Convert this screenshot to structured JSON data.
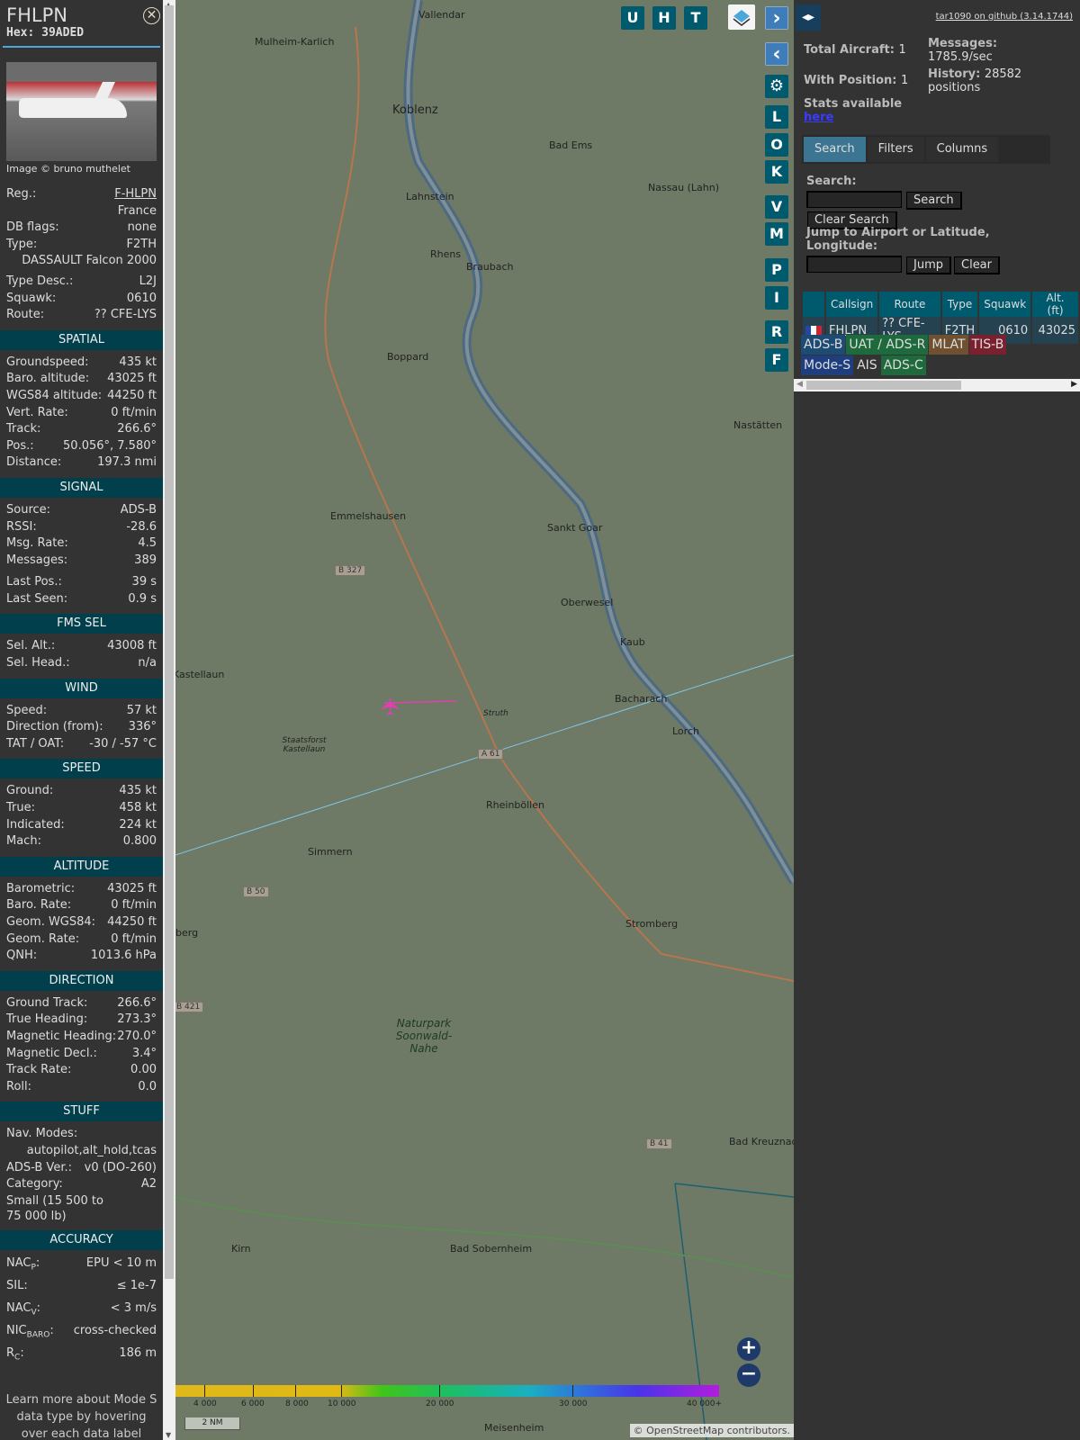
{
  "aircraft": {
    "callsign": "FHLPN",
    "hex_label": "Hex:",
    "hex": "39ADED",
    "image_credit": "Image © bruno muthelet"
  },
  "info": [
    {
      "label": "Reg.:",
      "value": "F-HLPN"
    },
    {
      "value": "France"
    },
    {
      "label": "DB flags:",
      "value": "none"
    },
    {
      "label": "Type:",
      "value": "F2TH"
    },
    {
      "value": "DASSAULT Falcon 2000"
    },
    {
      "label": "Type Desc.:",
      "value": "L2J"
    },
    {
      "label": "Squawk:",
      "value": "0610"
    },
    {
      "label": "Route:",
      "value": "?? CFE-LYS"
    }
  ],
  "sections": {
    "spatial": {
      "title": "SPATIAL",
      "rows": [
        {
          "label": "Groundspeed:",
          "value": "435 kt"
        },
        {
          "label": "Baro. altitude:",
          "value": "43025 ft"
        },
        {
          "label": "WGS84 altitude:",
          "value": "44250 ft"
        },
        {
          "label": "Vert. Rate:",
          "value": "0 ft/min"
        },
        {
          "label": "Track:",
          "value": "266.6°"
        },
        {
          "label": "Pos.:",
          "value": "50.056°, 7.580°"
        },
        {
          "label": "Distance:",
          "value": "197.3 nmi"
        }
      ]
    },
    "signal": {
      "title": "SIGNAL",
      "rows": [
        {
          "label": "Source:",
          "value": "ADS-B"
        },
        {
          "label": "RSSI:",
          "value": "-28.6"
        },
        {
          "label": "Msg. Rate:",
          "value": "4.5"
        },
        {
          "label": "Messages:",
          "value": "389"
        },
        {
          "label": "Last Pos.:",
          "value": "39 s"
        },
        {
          "label": "Last Seen:",
          "value": "0.9 s"
        }
      ]
    },
    "fms": {
      "title": "FMS SEL",
      "rows": [
        {
          "label": "Sel. Alt.:",
          "value": "43008 ft"
        },
        {
          "label": "Sel. Head.:",
          "value": "n/a"
        }
      ]
    },
    "wind": {
      "title": "WIND",
      "rows": [
        {
          "label": "Speed:",
          "value": "57 kt"
        },
        {
          "label": "Direction (from):",
          "value": "336°"
        },
        {
          "label": "TAT / OAT:",
          "value": "-30 / -57 °C"
        }
      ]
    },
    "speed": {
      "title": "SPEED",
      "rows": [
        {
          "label": "Ground:",
          "value": "435 kt"
        },
        {
          "label": "True:",
          "value": "458 kt"
        },
        {
          "label": "Indicated:",
          "value": "224 kt"
        },
        {
          "label": "Mach:",
          "value": "0.800"
        }
      ]
    },
    "altitude": {
      "title": "ALTITUDE",
      "rows": [
        {
          "label": "Barometric:",
          "value": "43025 ft"
        },
        {
          "label": "Baro. Rate:",
          "value": "0 ft/min"
        },
        {
          "label": "Geom. WGS84:",
          "value": "44250 ft"
        },
        {
          "label": "Geom. Rate:",
          "value": "0 ft/min"
        },
        {
          "label": "QNH:",
          "value": "1013.6 hPa"
        }
      ]
    },
    "direction": {
      "title": "DIRECTION",
      "rows": [
        {
          "label": "Ground Track:",
          "value": "266.6°"
        },
        {
          "label": "True Heading:",
          "value": "273.3°"
        },
        {
          "label": "Magnetic Heading:",
          "value": "270.0°"
        },
        {
          "label": "Magnetic Decl.:",
          "value": "3.4°"
        },
        {
          "label": "Track Rate:",
          "value": "0.00"
        },
        {
          "label": "Roll:",
          "value": "0.0"
        }
      ]
    },
    "stuff": {
      "title": "STUFF",
      "nav_label": "Nav. Modes:",
      "nav_value": "autopilot,alt_hold,tcas",
      "rows": [
        {
          "label": "ADS-B Ver.:",
          "value": "v0 (DO-260)"
        },
        {
          "label": "Category:",
          "value": "A2"
        }
      ],
      "category_desc": "Small (15 500 to 75 000 lb)"
    },
    "accuracy": {
      "title": "ACCURACY",
      "rows": [
        {
          "label": "NAC",
          "sub": "P",
          "value": "EPU < 10 m"
        },
        {
          "label": "SIL",
          "sub": "",
          "value": "≤ 1e-7"
        },
        {
          "label": "NAC",
          "sub": "V",
          "value": "< 3 m/s"
        },
        {
          "label": "NIC",
          "sub": "BARO",
          "value": "cross-checked"
        },
        {
          "label": "R",
          "sub": "C",
          "value": "186 m"
        }
      ]
    }
  },
  "learn_more": "Learn more about Mode S data type by hovering over each data label",
  "map": {
    "buttons": [
      "U",
      "H",
      "T",
      "L",
      "O",
      "K",
      "V",
      "M",
      "P",
      "I",
      "R",
      "F"
    ],
    "labels": [
      "Vallendar",
      "Mulheim-Karlich",
      "Koblenz",
      "Bad Ems",
      "Lahnstein",
      "Nassau (Lahn)",
      "Rhens",
      "Braubach",
      "Boppard",
      "Nastätten",
      "Emmelshausen",
      "Sankt Goar",
      "Oberwesel",
      "Kaub",
      "Kastellaun",
      "Bacharach",
      "Struth",
      "Lorch",
      "Staatsforst Kastellaun",
      "Rheinböllen",
      "Simmern",
      "Stromberg",
      "berg",
      "Naturpark Soonwald-Nahe",
      "Bad Kreuznach",
      "Kirn",
      "Bad Sobernheim",
      "Meisenheim"
    ],
    "roads": [
      "B 327",
      "A 61",
      "B 50",
      "B 421",
      "B 41"
    ],
    "colorbar_ticks": [
      "4 000",
      "6 000",
      "8 000",
      "10 000",
      "20 000",
      "30 000",
      "40 000+"
    ],
    "scale": "2 NM",
    "attribution_prefix": "© ",
    "attribution_link": "OpenStreetMap",
    "attribution_suffix": " contributors."
  },
  "right": {
    "github": "tar1090 on github (3.14.1744)",
    "total_label": "Total Aircraft:",
    "total": "1",
    "pos_label": "With Position:",
    "pos": "1",
    "msg_label": "Messages:",
    "msg": "1785.9/sec",
    "hist_label": "History:",
    "hist": "28582 positions",
    "stats_label": "Stats available",
    "stats_link": "here",
    "tabs": [
      "Search",
      "Filters",
      "Columns"
    ],
    "search_label": "Search:",
    "search_value": "",
    "search_btn": "Search",
    "clear_search_btn": "Clear Search",
    "jump_label": "Jump to Airport or Latitude, Longitude:",
    "jump_value": "",
    "jump_btn": "Jump",
    "clear_btn": "Clear",
    "table": {
      "headers": [
        "",
        "Callsign",
        "Route",
        "Type",
        "Squawk",
        "Alt. (ft)"
      ],
      "rows": [
        {
          "flag": "France",
          "callsign": "FHLPN",
          "route": "?? CFE-LYS",
          "type": "F2TH",
          "squawk": "0610",
          "alt": "43025"
        }
      ]
    },
    "legend": [
      {
        "label": "ADS-B",
        "color": "#1e4b73"
      },
      {
        "label": "UAT / ADS-R",
        "color": "#1f6a3c"
      },
      {
        "label": "MLAT",
        "color": "#6f5132"
      },
      {
        "label": "TIS-B",
        "color": "#7a2130"
      },
      {
        "label": "Mode-S",
        "color": "#1e3e80"
      },
      {
        "label": "AIS",
        "color": "transparent"
      },
      {
        "label": "ADS-C",
        "color": "#1f6a3c"
      }
    ]
  }
}
